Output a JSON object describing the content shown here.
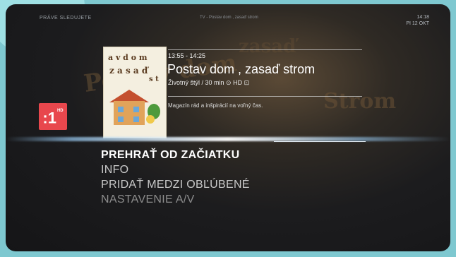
{
  "header": {
    "now_watching": "PRÁVE SLEDUJETE",
    "breadcrumb": "TV - Postav dom , zasaď strom",
    "clock_time": "14:18",
    "clock_date": "PI 12 OKT"
  },
  "channel": {
    "logo_text": ":1",
    "logo_badge": "HD"
  },
  "poster": {
    "line1": "a v d o m",
    "line2": "z a s a ď",
    "line3": "s t"
  },
  "background_title": {
    "word1": "Postav dom",
    "word2": "Strom",
    "word3": "zasaď"
  },
  "program": {
    "time": "13:55 - 14:25",
    "title": "Postav dom , zasaď strom",
    "meta": "Životný štýl / 30 min  ⊙ HD ⊡",
    "description": "Magazín rád a inšpirácií na voľný čas."
  },
  "menu": {
    "items": [
      {
        "label": "PREHRAŤ OD ZAČIATKU"
      },
      {
        "label": "INFO"
      },
      {
        "label": "PRIDAŤ MEDZI OBĽÚBENÉ"
      },
      {
        "label": "NASTAVENIE A/V"
      }
    ]
  }
}
